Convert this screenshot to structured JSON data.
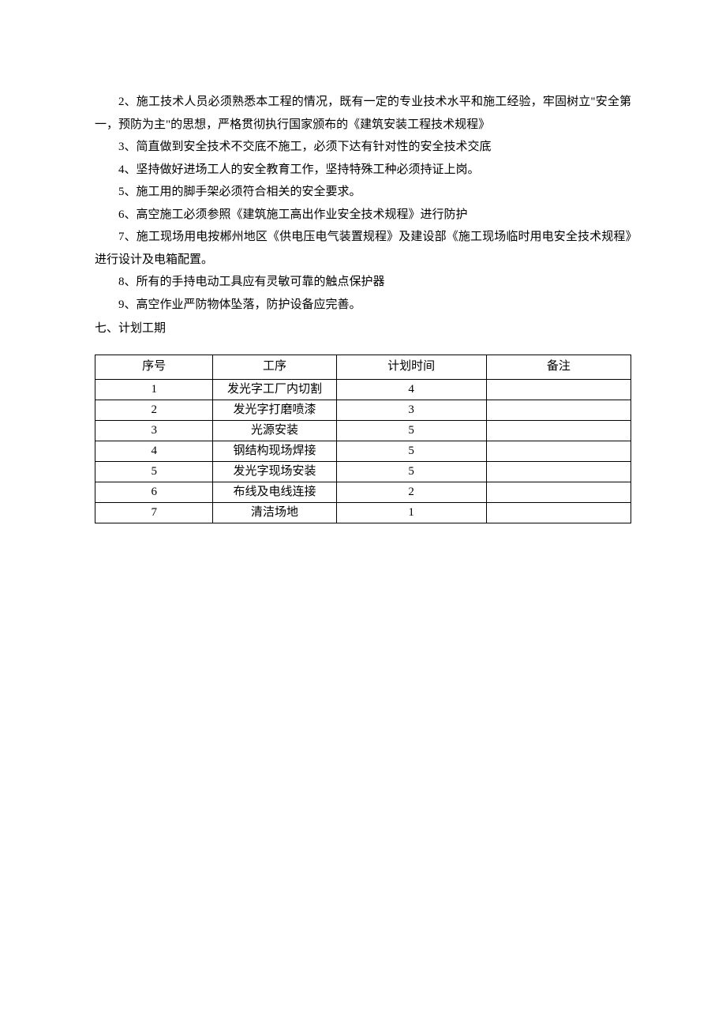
{
  "paragraphs": {
    "p2": "2、施工技术人员必须熟悉本工程的情况，既有一定的专业技术水平和施工经验，牢固树立\"安全第一，预防为主\"的思想，严格贯彻执行国家颁布的《建筑安装工程技术规程》",
    "p3": "3、简直做到安全技术不交底不施工，必须下达有针对性的安全技术交底",
    "p4": "4、坚持做好进场工人的安全教育工作，坚持特殊工种必须持证上岗。",
    "p5": "5、施工用的脚手架必须符合相关的安全要求。",
    "p6": "6、高空施工必须参照《建筑施工高出作业安全技术规程》进行防护",
    "p7": "7、施工现场用电按郴州地区《供电压电气装置规程》及建设部《施工现场临时用电安全技术规程》进行设计及电箱配置。",
    "p8": "8、所有的手持电动工具应有灵敏可靠的触点保护器",
    "p9": "9、高空作业严防物体坠落，防护设备应完善。"
  },
  "section": "七、计划工期",
  "table": {
    "headers": {
      "c1": "序号",
      "c2": "工序",
      "c3": "计划时间",
      "c4": "备注"
    },
    "rows": [
      {
        "no": "1",
        "step": "发光字工厂内切割",
        "time": "4",
        "note": ""
      },
      {
        "no": "2",
        "step": "发光字打磨喷漆",
        "time": "3",
        "note": ""
      },
      {
        "no": "3",
        "step": "光源安装",
        "time": "5",
        "note": ""
      },
      {
        "no": "4",
        "step": "钢结构现场焊接",
        "time": "5",
        "note": ""
      },
      {
        "no": "5",
        "step": "发光字现场安装",
        "time": "5",
        "note": ""
      },
      {
        "no": "6",
        "step": "布线及电线连接",
        "time": "2",
        "note": ""
      },
      {
        "no": "7",
        "step": "清洁场地",
        "time": "1",
        "note": ""
      }
    ]
  }
}
